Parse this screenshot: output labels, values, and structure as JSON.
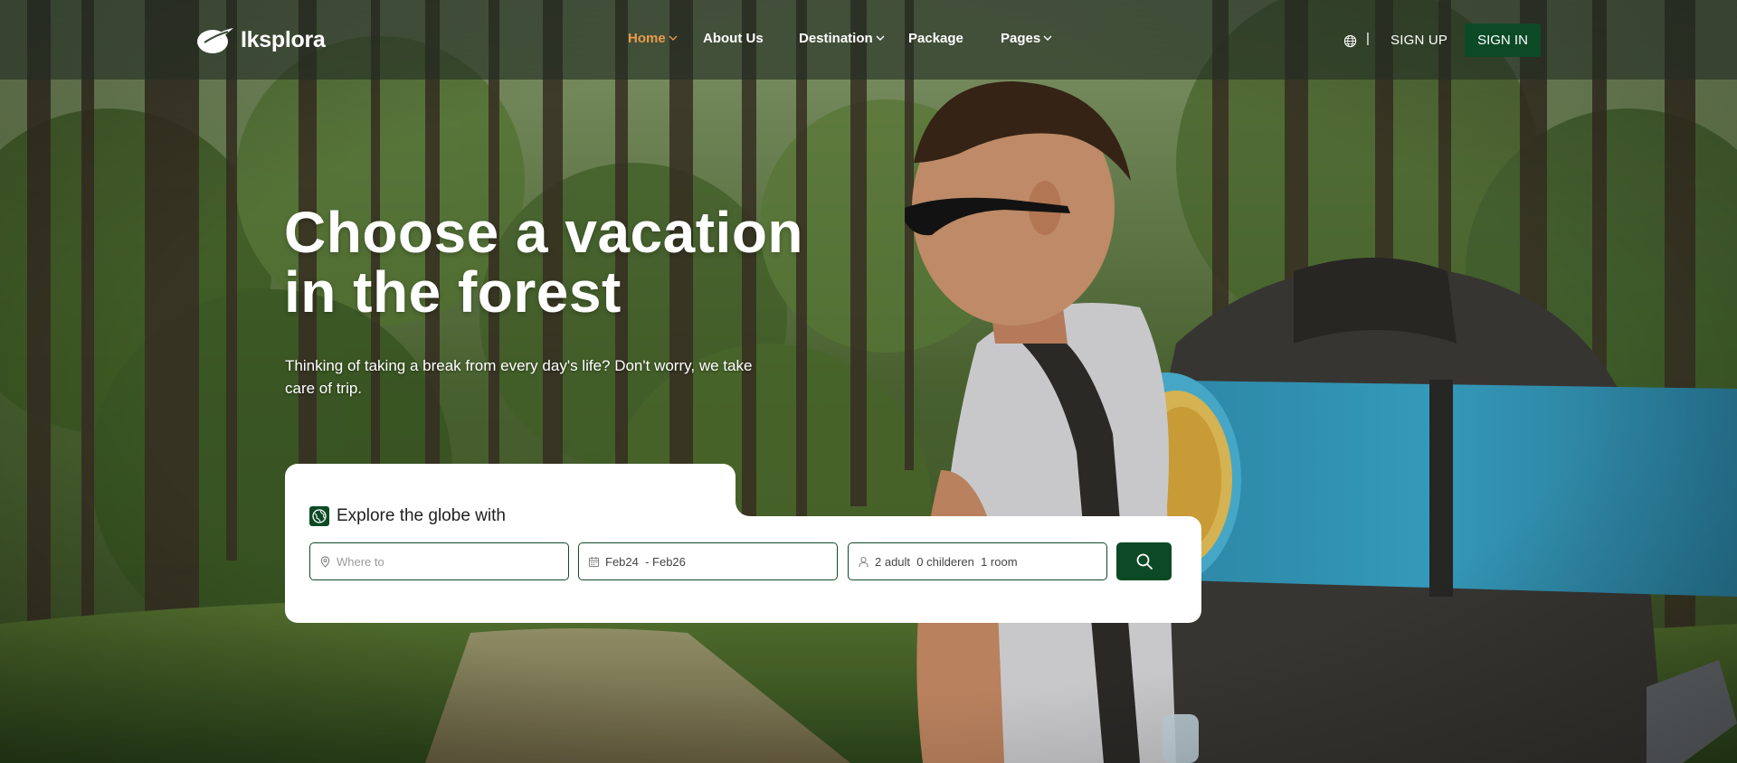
{
  "brand": {
    "name": "Iksplora"
  },
  "nav": {
    "items": [
      {
        "label": "Home",
        "has_dropdown": true,
        "active": true
      },
      {
        "label": "About Us",
        "has_dropdown": false,
        "active": false
      },
      {
        "label": "Destination",
        "has_dropdown": true,
        "active": false
      },
      {
        "label": "Package",
        "has_dropdown": false,
        "active": false
      },
      {
        "label": "Pages",
        "has_dropdown": true,
        "active": false
      }
    ],
    "language_icon": "globe-icon",
    "divider": "|",
    "signup_label": "SIGN UP",
    "signin_label": "SIGN IN"
  },
  "hero": {
    "title_line1": "Choose a vacation",
    "title_line2": "in the forest",
    "subtitle": "Thinking of taking a break from every day's life? Don't worry, we take care of trip."
  },
  "search": {
    "heading": "Explore the globe with",
    "heading_icon": "globe-badge-icon",
    "where": {
      "placeholder": "Where to",
      "value": "",
      "icon": "map-pin-icon"
    },
    "dates": {
      "value": "Feb24  - Feb26",
      "icon": "calendar-icon"
    },
    "guests": {
      "value": "2 adult  0 childeren  1 room",
      "icon": "user-icon"
    },
    "button_icon": "search-icon"
  },
  "colors": {
    "primary": "#0c4a26",
    "nav_active": "#e89a4c",
    "header_overlay": "rgba(35,45,35,0.62)",
    "text_light": "#ffffff"
  }
}
